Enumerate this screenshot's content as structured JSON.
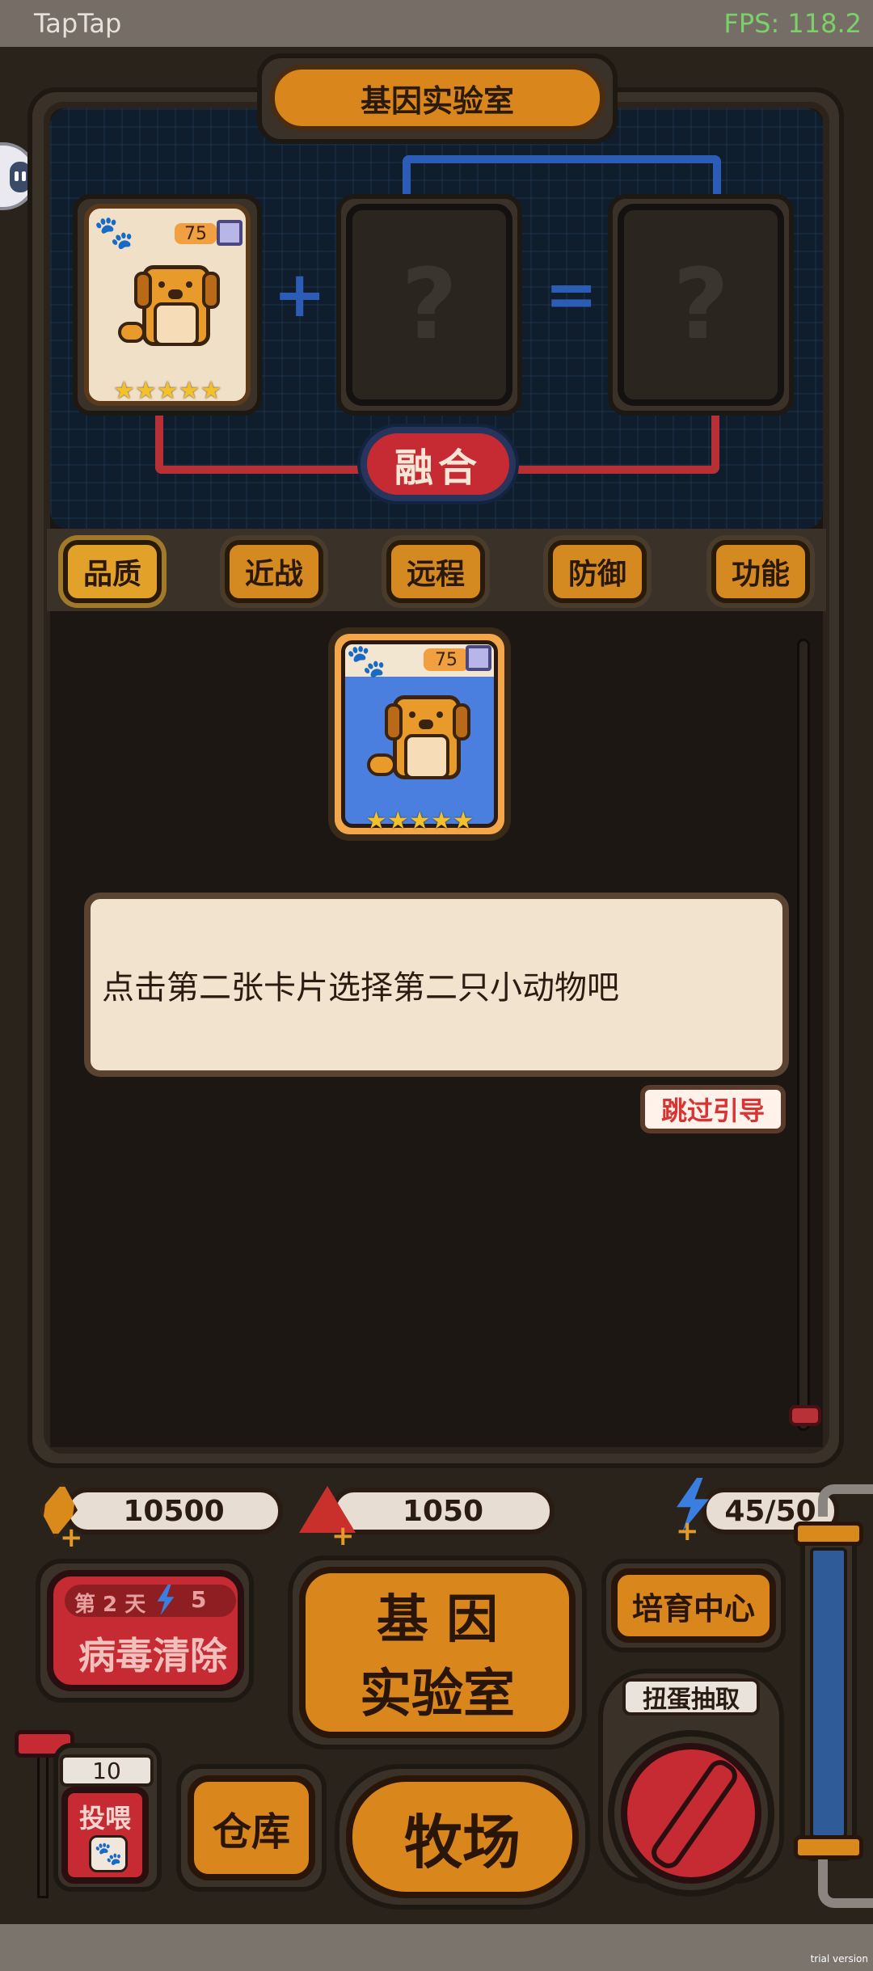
{
  "status_bar": {
    "app_name": "TapTap",
    "fps": "FPS: 118.2"
  },
  "header": {
    "title": "基因实验室"
  },
  "fusion": {
    "slot1": {
      "level": "75",
      "stars": "★★★★★"
    },
    "slot2_placeholder": "?",
    "slot3_placeholder": "?",
    "plus": "+",
    "equals": "=",
    "fuse_label": "融合"
  },
  "tabs": [
    "品质",
    "近战",
    "远程",
    "防御",
    "功能"
  ],
  "selected_card": {
    "level": "75",
    "stars": "★★★★★"
  },
  "guide": {
    "message": "点击第二张卡片选择第二只小动物吧",
    "skip_label": "跳过引导"
  },
  "resources": {
    "gold": "10500",
    "gems": "1050",
    "energy": "45/50"
  },
  "bottom": {
    "virus": {
      "day": "第 2 天",
      "cost": "5",
      "label": "病毒清除"
    },
    "gene_lab": {
      "line1": "基 因",
      "line2": "实验室"
    },
    "breeding": "培育中心",
    "gacha": "扭蛋抽取",
    "feed": {
      "count": "10",
      "label": "投喂"
    },
    "warehouse": "仓库",
    "ranch": "牧场"
  },
  "watermark": "trial version",
  "colors": {
    "accent_orange": "#d9861c",
    "accent_red": "#c62a32",
    "accent_blue": "#2b5db6",
    "card_blue": "#4a7fe0"
  }
}
